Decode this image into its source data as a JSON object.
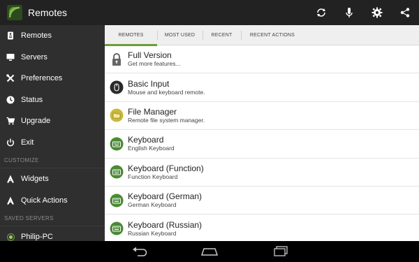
{
  "app": {
    "title": "Remotes"
  },
  "actionbar": {
    "icons": [
      "refresh-icon",
      "microphone-icon",
      "gear-icon",
      "share-icon"
    ]
  },
  "drawer": {
    "items": [
      {
        "label": "Remotes",
        "icon": "remotes-icon"
      },
      {
        "label": "Servers",
        "icon": "monitor-icon"
      },
      {
        "label": "Preferences",
        "icon": "tools-icon"
      },
      {
        "label": "Status",
        "icon": "status-icon"
      },
      {
        "label": "Upgrade",
        "icon": "cart-icon"
      },
      {
        "label": "Exit",
        "icon": "power-icon"
      }
    ],
    "customize_header": "CUSTOMIZE",
    "customize_items": [
      {
        "label": "Widgets",
        "icon": "widgets-icon"
      },
      {
        "label": "Quick Actions",
        "icon": "quick-actions-icon"
      }
    ],
    "saved_header": "SAVED SERVERS",
    "saved_servers": [
      {
        "label": "Philip-PC",
        "status_color": "#9bd25b"
      }
    ]
  },
  "tabs": [
    {
      "label": "REMOTES",
      "active": true
    },
    {
      "label": "MOST USED",
      "active": false
    },
    {
      "label": "RECENT",
      "active": false
    },
    {
      "label": "RECENT ACTIONS",
      "active": false
    }
  ],
  "list": [
    {
      "title": "Full Version",
      "subtitle": "Get more features...",
      "icon": "lock-icon"
    },
    {
      "title": "Basic Input",
      "subtitle": "Mouse and keyboard remote.",
      "icon": "mouse-icon"
    },
    {
      "title": "File Manager",
      "subtitle": "Remote file system manager.",
      "icon": "folder-icon"
    },
    {
      "title": "Keyboard",
      "subtitle": "English Keyboard",
      "icon": "keyboard-icon"
    },
    {
      "title": "Keyboard (Function)",
      "subtitle": "Function Keyboard",
      "icon": "keyboard-icon"
    },
    {
      "title": "Keyboard (German)",
      "subtitle": "German Keyboard",
      "icon": "keyboard-icon"
    },
    {
      "title": "Keyboard (Russian)",
      "subtitle": "Russian Keyboard",
      "icon": "keyboard-icon"
    }
  ],
  "navbar": {
    "icons": [
      "back-icon",
      "home-icon",
      "recent-apps-icon"
    ]
  },
  "colors": {
    "accent": "#6a9f3a",
    "actionbar_bg": "#222222",
    "drawer_bg": "#2f2f2f",
    "keyboard_circle": "#4a8a34",
    "folder_circle": "#c9b93a",
    "mouse_circle": "#2a2a2a"
  }
}
